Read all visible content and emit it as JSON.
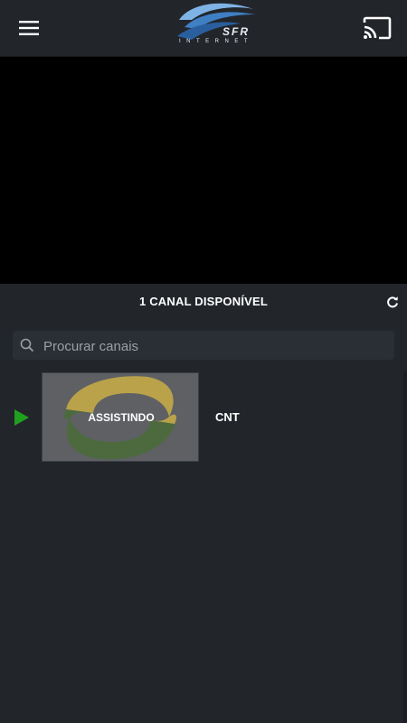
{
  "header": {
    "logo_text": "SFR",
    "logo_subtitle": "INTERNET",
    "icons": {
      "menu": "hamburger-menu-icon",
      "cast": "cast-icon"
    }
  },
  "channels": {
    "count_label": "1 CANAL DISPONÍVEL",
    "refresh_icon": "refresh-icon",
    "search": {
      "placeholder": "Procurar canais",
      "value": ""
    },
    "items": [
      {
        "name": "CNT",
        "status": "ASSISTINDO",
        "playing": true
      }
    ]
  },
  "colors": {
    "background": "#22262b",
    "player": "#000000",
    "play_indicator": "#1fa01f",
    "search_bg": "#2a2f35"
  }
}
